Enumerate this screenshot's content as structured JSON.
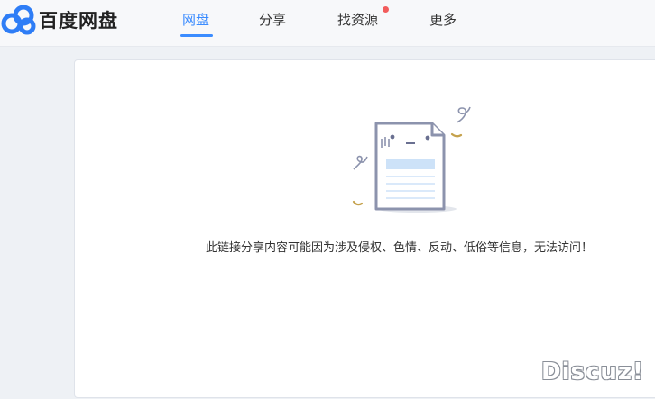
{
  "app": {
    "brand_name": "百度网盘",
    "brand_color": "#3b8cff"
  },
  "nav": {
    "items": [
      {
        "label": "网盘",
        "active": true
      },
      {
        "label": "分享",
        "active": false
      },
      {
        "label": "找资源",
        "active": false,
        "badge": "red-dot"
      },
      {
        "label": "更多",
        "active": false
      }
    ]
  },
  "main": {
    "illustration_icon": "sad-document-icon",
    "message": "此链接分享内容可能因为涉及侵权、色情、反动、低俗等信息，无法访问！"
  },
  "watermark": {
    "text": "Discuz!"
  }
}
